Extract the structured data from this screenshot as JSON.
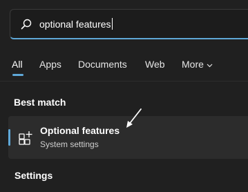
{
  "search": {
    "query": "optional features",
    "icon": "search-icon"
  },
  "tabs": [
    {
      "label": "All",
      "active": true
    },
    {
      "label": "Apps"
    },
    {
      "label": "Documents"
    },
    {
      "label": "Web"
    },
    {
      "label": "More"
    }
  ],
  "best_match": {
    "heading": "Best match",
    "title": "Optional features",
    "subtitle": "System settings",
    "icon": "optional-features-icon"
  },
  "settings": {
    "heading": "Settings"
  },
  "colors": {
    "background": "#202020",
    "accent": "#5fa8d8",
    "card": "#2c2c2c"
  }
}
